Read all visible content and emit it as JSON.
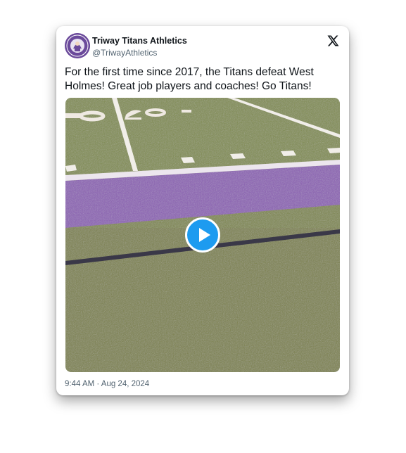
{
  "tweet": {
    "author": {
      "display_name": "Triway Titans Athletics",
      "handle": "@TriwayAthletics",
      "avatar_color": "#6b4a9b"
    },
    "brand_icon": "x-logo-icon",
    "text": "For the first time since 2017, the Titans defeat West Holmes! Great job players and coaches! Go Titans!",
    "media": {
      "type": "video",
      "field_yard_marker": "20",
      "turf_color": "#7d8648",
      "endzone_stripe_color": "#8a5bb4",
      "play_button_color": "#1d9bf0",
      "play_icon": "play-icon"
    },
    "timestamp": "9:44 AM · Aug 24, 2024"
  }
}
